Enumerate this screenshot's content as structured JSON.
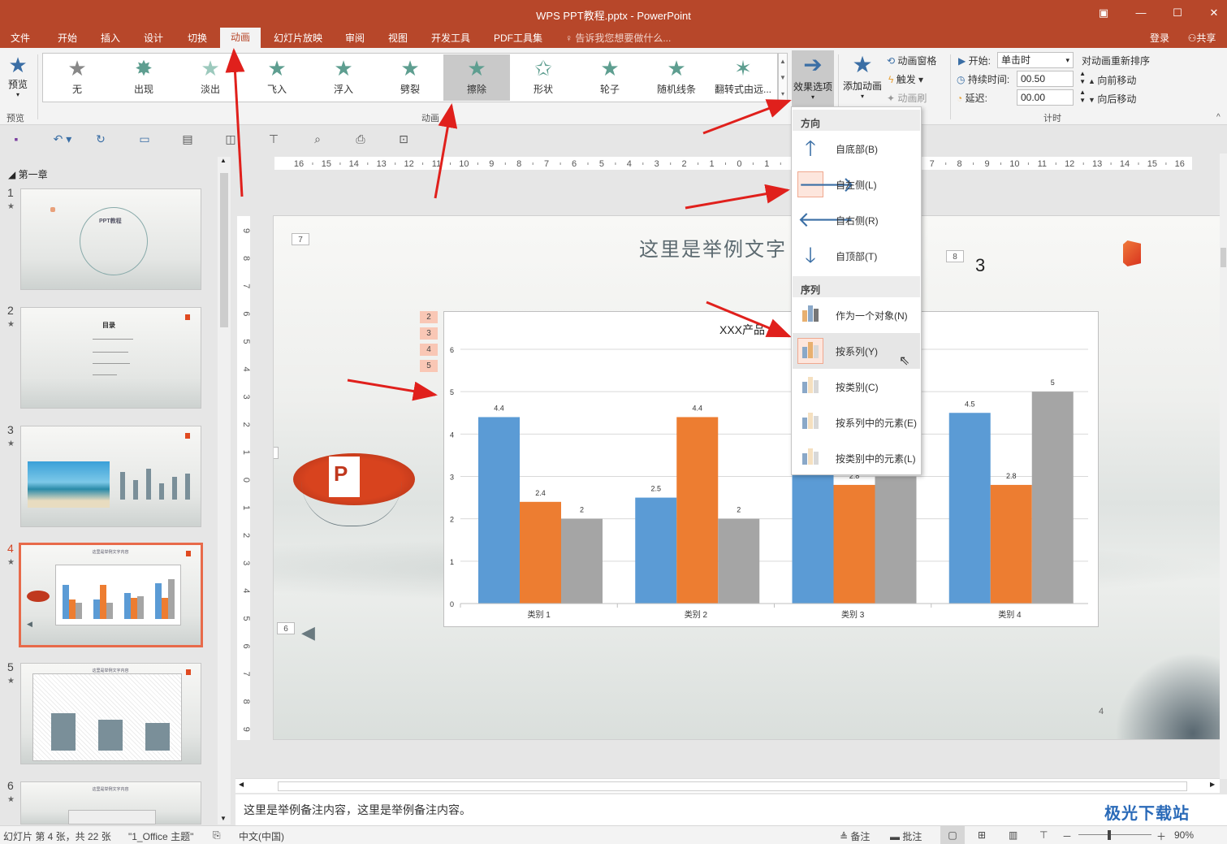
{
  "titlebar": {
    "title": "WPS PPT教程.pptx - PowerPoint"
  },
  "menubar": {
    "tabs": [
      "文件",
      "开始",
      "插入",
      "设计",
      "切换",
      "动画",
      "幻灯片放映",
      "审阅",
      "视图",
      "开发工具",
      "PDF工具集"
    ],
    "active_tab": "动画",
    "tellme": "告诉我您想要做什么...",
    "login": "登录",
    "share": "共享"
  },
  "ribbon": {
    "preview_label": "预览",
    "preview_group": "预览",
    "animations": [
      "无",
      "出现",
      "淡出",
      "飞入",
      "浮入",
      "劈裂",
      "擦除",
      "形状",
      "轮子",
      "随机线条",
      "翻转式由远..."
    ],
    "selected_animation": "擦除",
    "animation_group": "动画",
    "effect_options": "效果选项",
    "add_animation": "添加动画",
    "animation_pane": "动画窗格",
    "trigger": "触发",
    "animation_painter": "动画刷",
    "start_label": "开始:",
    "start_value": "单击时",
    "duration_label": "持续时间:",
    "duration_value": "00.50",
    "delay_label": "延迟:",
    "delay_value": "00.00",
    "reorder_title": "对动画重新排序",
    "move_earlier": "向前移动",
    "move_later": "向后移动",
    "timing_group": "计时"
  },
  "thumbnails": {
    "section": "第一章",
    "slides": [
      {
        "num": "1",
        "text": "PPT教程"
      },
      {
        "num": "2",
        "text": "目录"
      },
      {
        "num": "3",
        "text": ""
      },
      {
        "num": "4",
        "text": "这里是举例文字内容"
      },
      {
        "num": "5",
        "text": "这里是举例文字内容"
      },
      {
        "num": "6",
        "text": "这里是举例文字内容"
      }
    ],
    "active": "4"
  },
  "ruler": {
    "h_labels": [
      "16",
      "15",
      "14",
      "13",
      "12",
      "11",
      "10",
      "9",
      "8",
      "7",
      "6",
      "5",
      "4",
      "3",
      "2",
      "1",
      "0",
      "1",
      "2",
      "3",
      "4",
      "5",
      "6",
      "7",
      "8",
      "9",
      "10",
      "11",
      "12",
      "13",
      "14",
      "15",
      "16"
    ],
    "v_labels": [
      "9",
      "8",
      "7",
      "6",
      "5",
      "4",
      "3",
      "2",
      "1",
      "0",
      "1",
      "2",
      "3",
      "4",
      "5",
      "6",
      "7",
      "8",
      "9"
    ]
  },
  "slide": {
    "title": "这里是举例文字",
    "number_three": "3",
    "page_num": "4",
    "tags": {
      "t7": "7",
      "t8": "8",
      "t1": "1",
      "t6": "6",
      "o2": "2",
      "o3": "3",
      "o4": "4",
      "o5": "5"
    }
  },
  "chart_data": {
    "type": "bar",
    "title": "XXX产品",
    "categories": [
      "类别 1",
      "类别 2",
      "类别 3",
      "类别 4"
    ],
    "series": [
      {
        "values": [
          4.4,
          2.5,
          3.5,
          4.5
        ],
        "color": "#5b9bd5"
      },
      {
        "values": [
          2.4,
          4.4,
          2.8,
          2.8
        ],
        "color": "#ed7d31"
      },
      {
        "values": [
          2,
          2,
          3,
          5
        ],
        "color": "#a5a5a5"
      }
    ],
    "ylim": [
      0,
      6
    ],
    "yticks": [
      "0",
      "1",
      "2",
      "3",
      "4",
      "5",
      "6"
    ],
    "grid": true
  },
  "dropdown": {
    "direction_header": "方向",
    "directions": [
      "自底部(B)",
      "自左侧(L)",
      "自右侧(R)",
      "自顶部(T)"
    ],
    "sequence_header": "序列",
    "sequences": [
      "作为一个对象(N)",
      "按系列(Y)",
      "按类别(C)",
      "按系列中的元素(E)",
      "按类别中的元素(L)"
    ]
  },
  "notes": {
    "text": "这里是举例备注内容，这里是举例备注内容。"
  },
  "status": {
    "slide_info": "幻灯片 第 4 张，共 22 张",
    "theme": "\"1_Office 主题\"",
    "language": "中文(中国)",
    "notes_btn": "备注",
    "comments_btn": "批注",
    "zoom": "90%"
  },
  "watermark": {
    "text": "极光下载站"
  }
}
